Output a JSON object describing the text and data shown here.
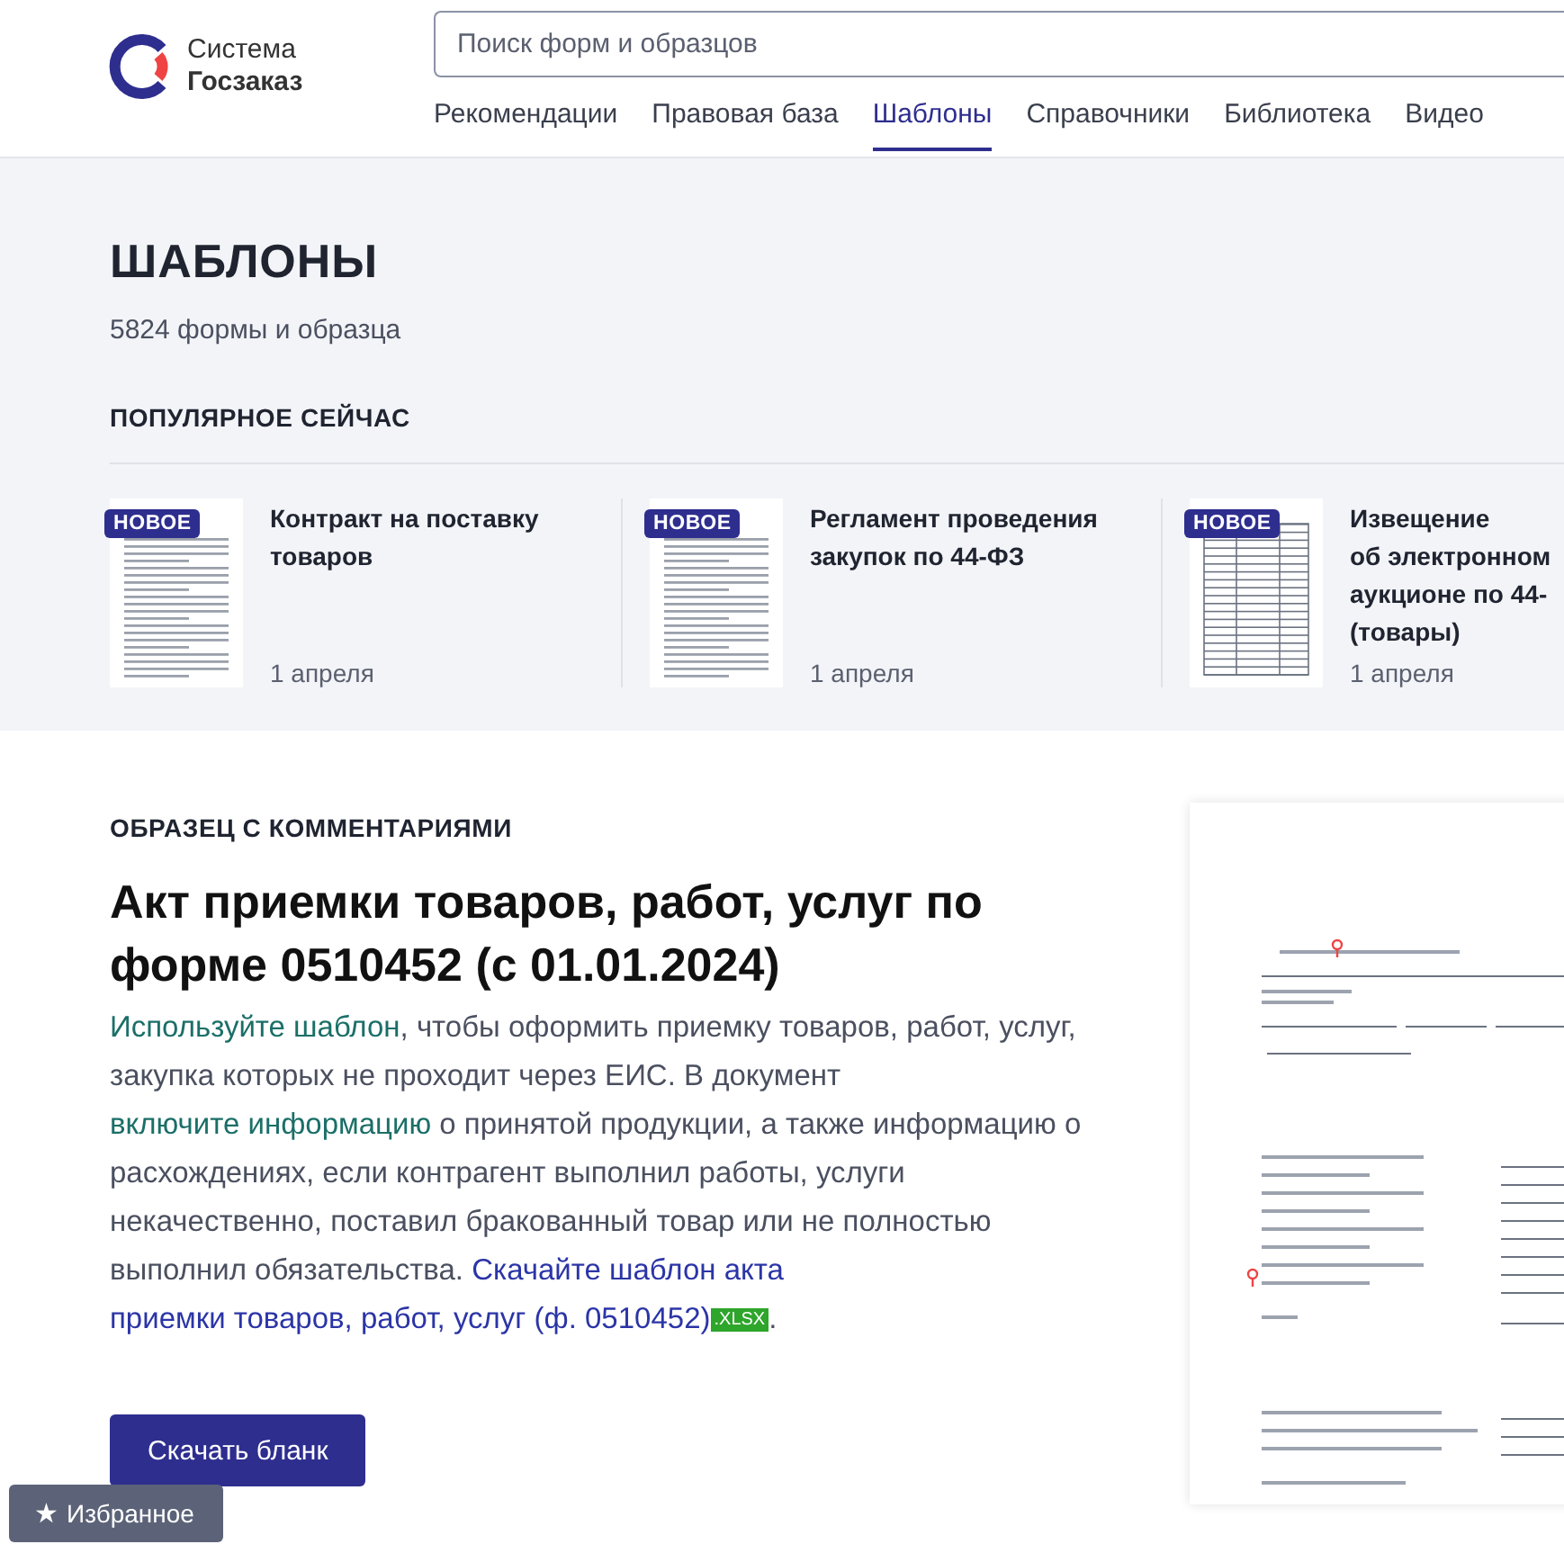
{
  "logo": {
    "line_1": "Система",
    "line_2": "Госзаказ"
  },
  "search": {
    "placeholder": "Поиск форм и образцов"
  },
  "nav": [
    {
      "label": "Рекомендации",
      "selected": false
    },
    {
      "label": "Правовая база",
      "selected": false
    },
    {
      "label": "Шаблоны",
      "selected": true
    },
    {
      "label": "Справочники",
      "selected": false
    },
    {
      "label": "Библиотека",
      "selected": false
    },
    {
      "label": "Видео",
      "selected": false
    }
  ],
  "page_title": "ШАБЛОНЫ",
  "count": "5824 формы и образца",
  "popular": {
    "heading": "ПОПУЛЯРНОЕ СЕЙЧАС",
    "cards": [
      {
        "badge": "НОВОЕ",
        "kind": "text",
        "title_lines": [
          "Контракт на поставку",
          "товаров"
        ],
        "date": "1 апреля"
      },
      {
        "badge": "НОВОЕ",
        "kind": "text",
        "title_lines": [
          "Регламент проведения",
          "закупок по 44-ФЗ"
        ],
        "date": "1 апреля"
      },
      {
        "badge": "НОВОЕ",
        "kind": "table",
        "title_lines": [
          "Извещение",
          "об электронном",
          "аукционе по 44-",
          "(товары)"
        ],
        "date": "1 апреля"
      }
    ]
  },
  "article": {
    "eyebrow": "ОБРАЗЕЦ С КОММЕНТАРИЯМИ",
    "title": "Акт приемки товаров, работ, услуг по форме 0510452 (с 01.01.2024)",
    "body": [
      {
        "kind": "link",
        "text": "Используйте шаблон"
      },
      {
        "kind": "text",
        "text": ", чтобы оформить приемку товаров, работ, услуг, закупка которых не проходит через ЕИС. В документ "
      },
      {
        "kind": "link",
        "text": "включите информацию"
      },
      {
        "kind": "text",
        "text": " о принятой продукции, а также информацию о расхождениях, если контрагент выполнил работы, услуги некачественно, поставил бракованный товар или не полностью выполнил обязательства. "
      },
      {
        "kind": "download",
        "text": "Скачайте шаблон акта"
      },
      {
        "kind": "download",
        "text": "приемки товаров, работ, услуг (ф. 0510452)"
      },
      {
        "kind": "file",
        "text": ".XLSX"
      },
      {
        "kind": "text",
        "text": "."
      }
    ],
    "button": "Скачать бланк"
  },
  "favorites": {
    "icon": "★",
    "label": "Избранное"
  }
}
